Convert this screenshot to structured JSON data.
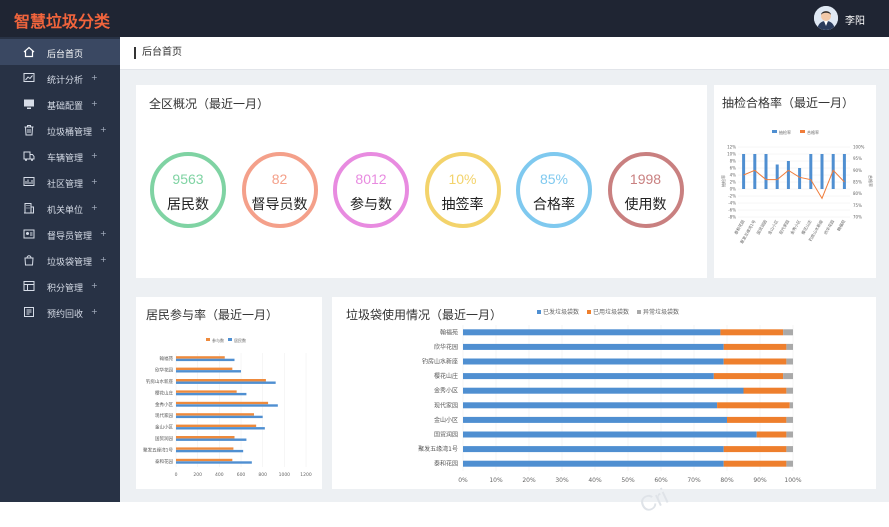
{
  "header": {
    "app_title": "智慧垃圾分类",
    "user_name": "李阳"
  },
  "sidebar": {
    "items": [
      {
        "label": "后台首页",
        "icon": "home-icon",
        "active": true,
        "plus": ""
      },
      {
        "label": "统计分析",
        "icon": "chart-icon",
        "plus": "+"
      },
      {
        "label": "基础配置",
        "icon": "monitor-icon",
        "plus": "+"
      },
      {
        "label": "垃圾桶管理",
        "icon": "trash-icon",
        "plus": "+"
      },
      {
        "label": "车辆管理",
        "icon": "truck-icon",
        "plus": "+"
      },
      {
        "label": "社区管理",
        "icon": "community-icon",
        "plus": "+"
      },
      {
        "label": "机关单位",
        "icon": "building-icon",
        "plus": "+"
      },
      {
        "label": "督导员管理",
        "icon": "supervisor-icon",
        "plus": "+"
      },
      {
        "label": "垃圾袋管理",
        "icon": "bag-icon",
        "plus": "+"
      },
      {
        "label": "积分管理",
        "icon": "points-icon",
        "plus": "+"
      },
      {
        "label": "预约回收",
        "icon": "appointment-icon",
        "plus": "+"
      }
    ]
  },
  "breadcrumb": "后台首页",
  "overview": {
    "title": "全区概况（最近一月）",
    "stats": [
      {
        "value": "9563",
        "label": "居民数",
        "color": "#7fd3a3"
      },
      {
        "value": "82",
        "label": "督导员数",
        "color": "#f4a08a"
      },
      {
        "value": "8012",
        "label": "参与数",
        "color": "#e88be0"
      },
      {
        "value": "10%",
        "label": "抽签率",
        "color": "#f3d36b"
      },
      {
        "value": "85%",
        "label": "合格率",
        "color": "#7fc9ef"
      },
      {
        "value": "1998",
        "label": "使用数",
        "color": "#c98080"
      }
    ]
  },
  "sampling": {
    "title": "抽检合格率（最近一月）"
  },
  "participation": {
    "title": "居民参与率（最近一月）"
  },
  "bags": {
    "title": "垃圾袋使用情况（最近一月）"
  },
  "watermark": "Cri",
  "chart_data": [
    {
      "type": "bar+line",
      "categories": [
        "泰和花园",
        "聚发五缘湾1号",
        "国贸润园",
        "金山小区",
        "现代家园",
        "金秀小区",
        "樱花山庄",
        "钓房山水新座",
        "欣华花园",
        "翰福苑"
      ],
      "legend": [
        "抽检率",
        "合格率"
      ],
      "bar_color": "#4f8fd1",
      "line_color": "#f07c3a",
      "yticks_left": [
        "12%",
        "10%",
        "8%",
        "6%",
        "4%",
        "2%",
        "0%",
        "-2%",
        "-4%",
        "-6%",
        "-8%"
      ],
      "yticks_right": [
        "100%",
        "95%",
        "90%",
        "85%",
        "80%",
        "75%",
        "70%"
      ],
      "ylabel_left": "抽检率",
      "ylabel_right": "合格率",
      "series": [
        {
          "name": "抽检率",
          "values": [
            10,
            10,
            10,
            7,
            8,
            6,
            10,
            10,
            10,
            10
          ]
        },
        {
          "name": "合格率",
          "values": [
            88,
            90,
            86,
            86,
            90,
            87,
            86,
            78,
            90,
            85
          ]
        }
      ]
    },
    {
      "type": "bar",
      "orientation": "horizontal",
      "categories": [
        "翰福苑",
        "欣华花园",
        "钓房山水新座",
        "樱花山庄",
        "金秀小区",
        "现代家园",
        "金山小区",
        "国贸润园",
        "聚发五缘湾1号",
        "泰和花园"
      ],
      "legend": [
        "参与数",
        "居民数"
      ],
      "colors": [
        "#ee8a3c",
        "#4f8fd1"
      ],
      "xticks": [
        "0",
        "200",
        "400",
        "600",
        "800",
        "1000",
        "1200"
      ],
      "xlim": [
        0,
        1200
      ],
      "series": [
        {
          "name": "参与数",
          "values": [
            450,
            520,
            830,
            560,
            850,
            720,
            740,
            540,
            530,
            520
          ]
        },
        {
          "name": "居民数",
          "values": [
            540,
            600,
            920,
            650,
            940,
            800,
            820,
            650,
            620,
            700
          ]
        }
      ]
    },
    {
      "type": "bar",
      "orientation": "horizontal",
      "stacked": true,
      "categories": [
        "翰福苑",
        "欣华花园",
        "钓房山水新座",
        "樱花山庄",
        "金秀小区",
        "现代家园",
        "金山小区",
        "国贸润园",
        "聚发五缘湾1号",
        "泰和花园"
      ],
      "legend": [
        "已发垃圾袋数",
        "已用垃圾袋数",
        "异常垃圾袋数"
      ],
      "colors": [
        "#4f8fd1",
        "#ee7f2d",
        "#a9a9a9"
      ],
      "xticks": [
        "0%",
        "10%",
        "20%",
        "30%",
        "40%",
        "50%",
        "60%",
        "70%",
        "80%",
        "90%",
        "100%"
      ],
      "xlim": [
        0,
        100
      ],
      "series": [
        {
          "name": "已发垃圾袋数",
          "values": [
            78,
            79,
            79,
            76,
            85,
            77,
            80,
            89,
            79,
            79
          ]
        },
        {
          "name": "已用垃圾袋数",
          "values": [
            19,
            19,
            19,
            21,
            13,
            22,
            18,
            9,
            19,
            19
          ]
        },
        {
          "name": "异常垃圾袋数",
          "values": [
            3,
            2,
            2,
            3,
            2,
            1,
            2,
            2,
            2,
            2
          ]
        }
      ]
    }
  ]
}
